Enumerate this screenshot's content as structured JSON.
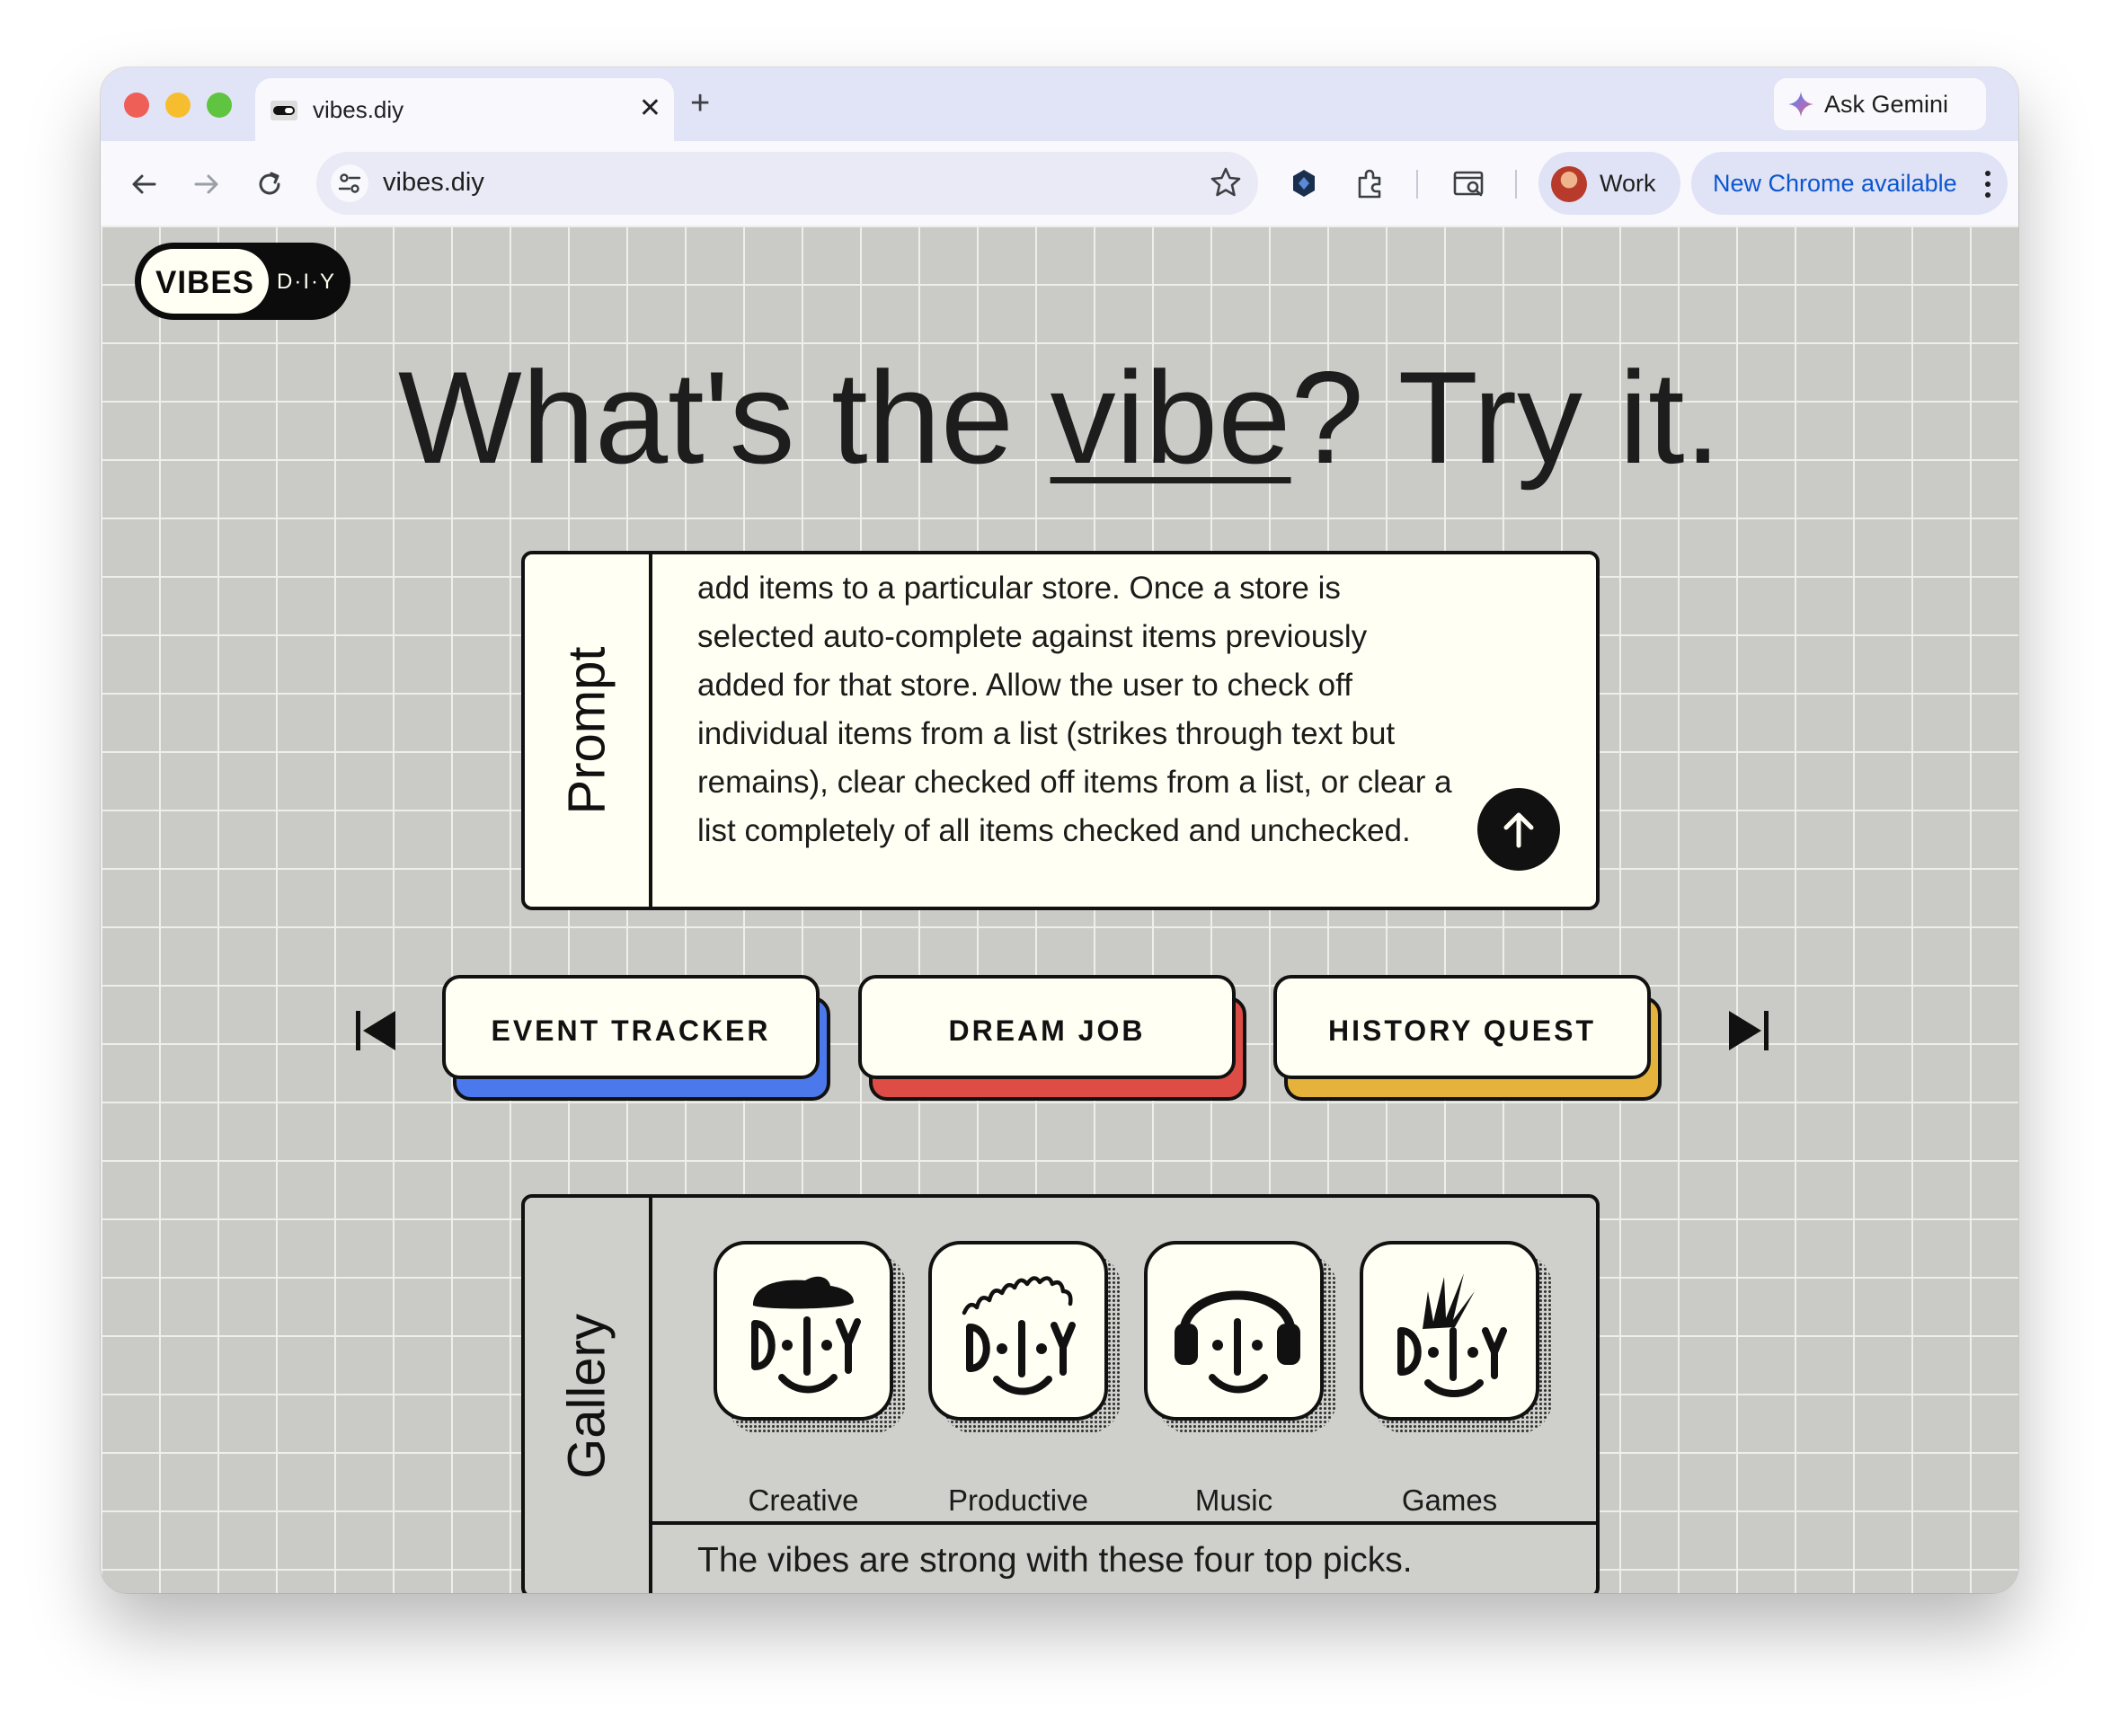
{
  "browser": {
    "tab_title": "vibes.diy",
    "url": "vibes.diy",
    "ask_gemini_label": "Ask Gemini",
    "profile_label": "Work",
    "update_label": "New Chrome available"
  },
  "logo": {
    "vibes": "VIBES",
    "diy": "D·I·Y"
  },
  "headline": {
    "before": "What's the ",
    "emphasis": "vibe",
    "after": "? Try it."
  },
  "prompt": {
    "label": "Prompt",
    "text": "add items to a particular store. Once a store is selected auto-complete against items previously added for that store. Allow the user to check off individual items from a list (strikes through text but remains), clear checked off items from a list, or clear a list completely of all items checked and unchecked."
  },
  "quick_picks": [
    {
      "label": "EVENT TRACKER",
      "color": "#4b78ea"
    },
    {
      "label": "DREAM JOB",
      "color": "#de4d45"
    },
    {
      "label": "HISTORY QUEST",
      "color": "#e5b23c"
    }
  ],
  "gallery": {
    "label": "Gallery",
    "items": [
      {
        "label": "Creative",
        "icon": "beret-face-icon"
      },
      {
        "label": "Productive",
        "icon": "curly-hair-face-icon"
      },
      {
        "label": "Music",
        "icon": "headphones-face-icon"
      },
      {
        "label": "Games",
        "icon": "spiky-hair-face-icon"
      }
    ],
    "caption": "The vibes are strong with these four top picks."
  }
}
